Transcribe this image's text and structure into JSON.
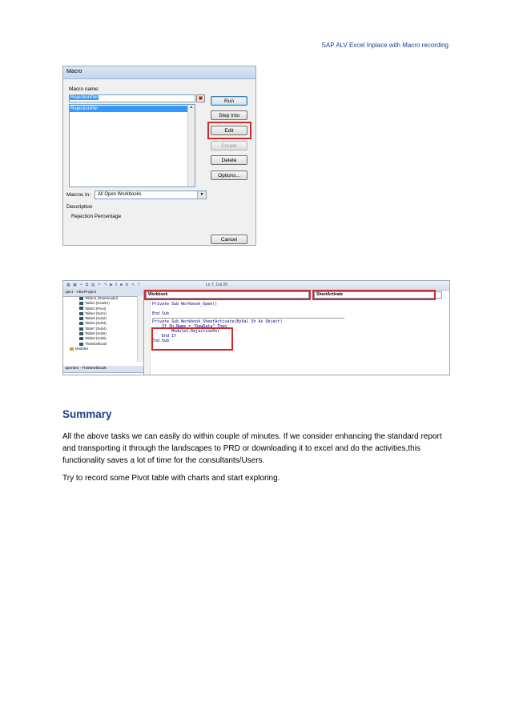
{
  "header": {
    "title": "SAP ALV Excel Inplace with Macro recording"
  },
  "macro_dialog": {
    "title": "Macro",
    "macro_name_label": "Macro name:",
    "macro_name_value": "RejectionPer",
    "macro_list": [
      "RejectionPer"
    ],
    "buttons": {
      "run": "Run",
      "step_into": "Step Into",
      "edit": "Edit",
      "create": "Create",
      "delete": "Delete",
      "options": "Options...",
      "cancel": "Cancel"
    },
    "macros_in_label": "Macros in:",
    "macros_in_value": "All Open Workbooks",
    "description_label": "Description",
    "description_value": "Rejection Percentage"
  },
  "vba_editor": {
    "cursor_position": "Ln 7, Col 29",
    "project_title": "oject - VBAProject",
    "tree_items": [
      "Table11 (RawHeader)",
      "Table2 (Header)",
      "Table3 (Pivot)",
      "Table4 (Sub1)",
      "Table5 (Sub2)",
      "Table6 (Sub3)",
      "Table7 (Sub4)",
      "Table8 (Sub5)",
      "Table9 (Sub6)",
      "ThisWorkbook",
      "Modules"
    ],
    "properties_title": "operties - ThisWorkbook",
    "object_combo": "Workbook",
    "procedure_combo": "SheetActivate",
    "code_lines": [
      "Private Sub Workbook_Open()",
      "",
      "End Sub",
      "Private Sub Workbook_SheetActivate(ByVal Sh As Object)",
      "    If Sh.Name = \"RawData\" Then",
      "        Module1.RejectionPer",
      "    End If",
      "End Sub"
    ]
  },
  "summary": {
    "heading": "Summary",
    "paragraph1": "All the above tasks we can easily do within couple of minutes. If we consider enhancing the standard report and transporting it through the landscapes to PRD or downloading it to excel and do the activities,this functionality saves a lot of time for the consultants/Users.",
    "paragraph2": "Try to record some Pivot table with charts and start exploring."
  },
  "colors": {
    "accent": "#1f3f8f",
    "highlight": "#d02a2a",
    "selection": "#3399ff"
  }
}
